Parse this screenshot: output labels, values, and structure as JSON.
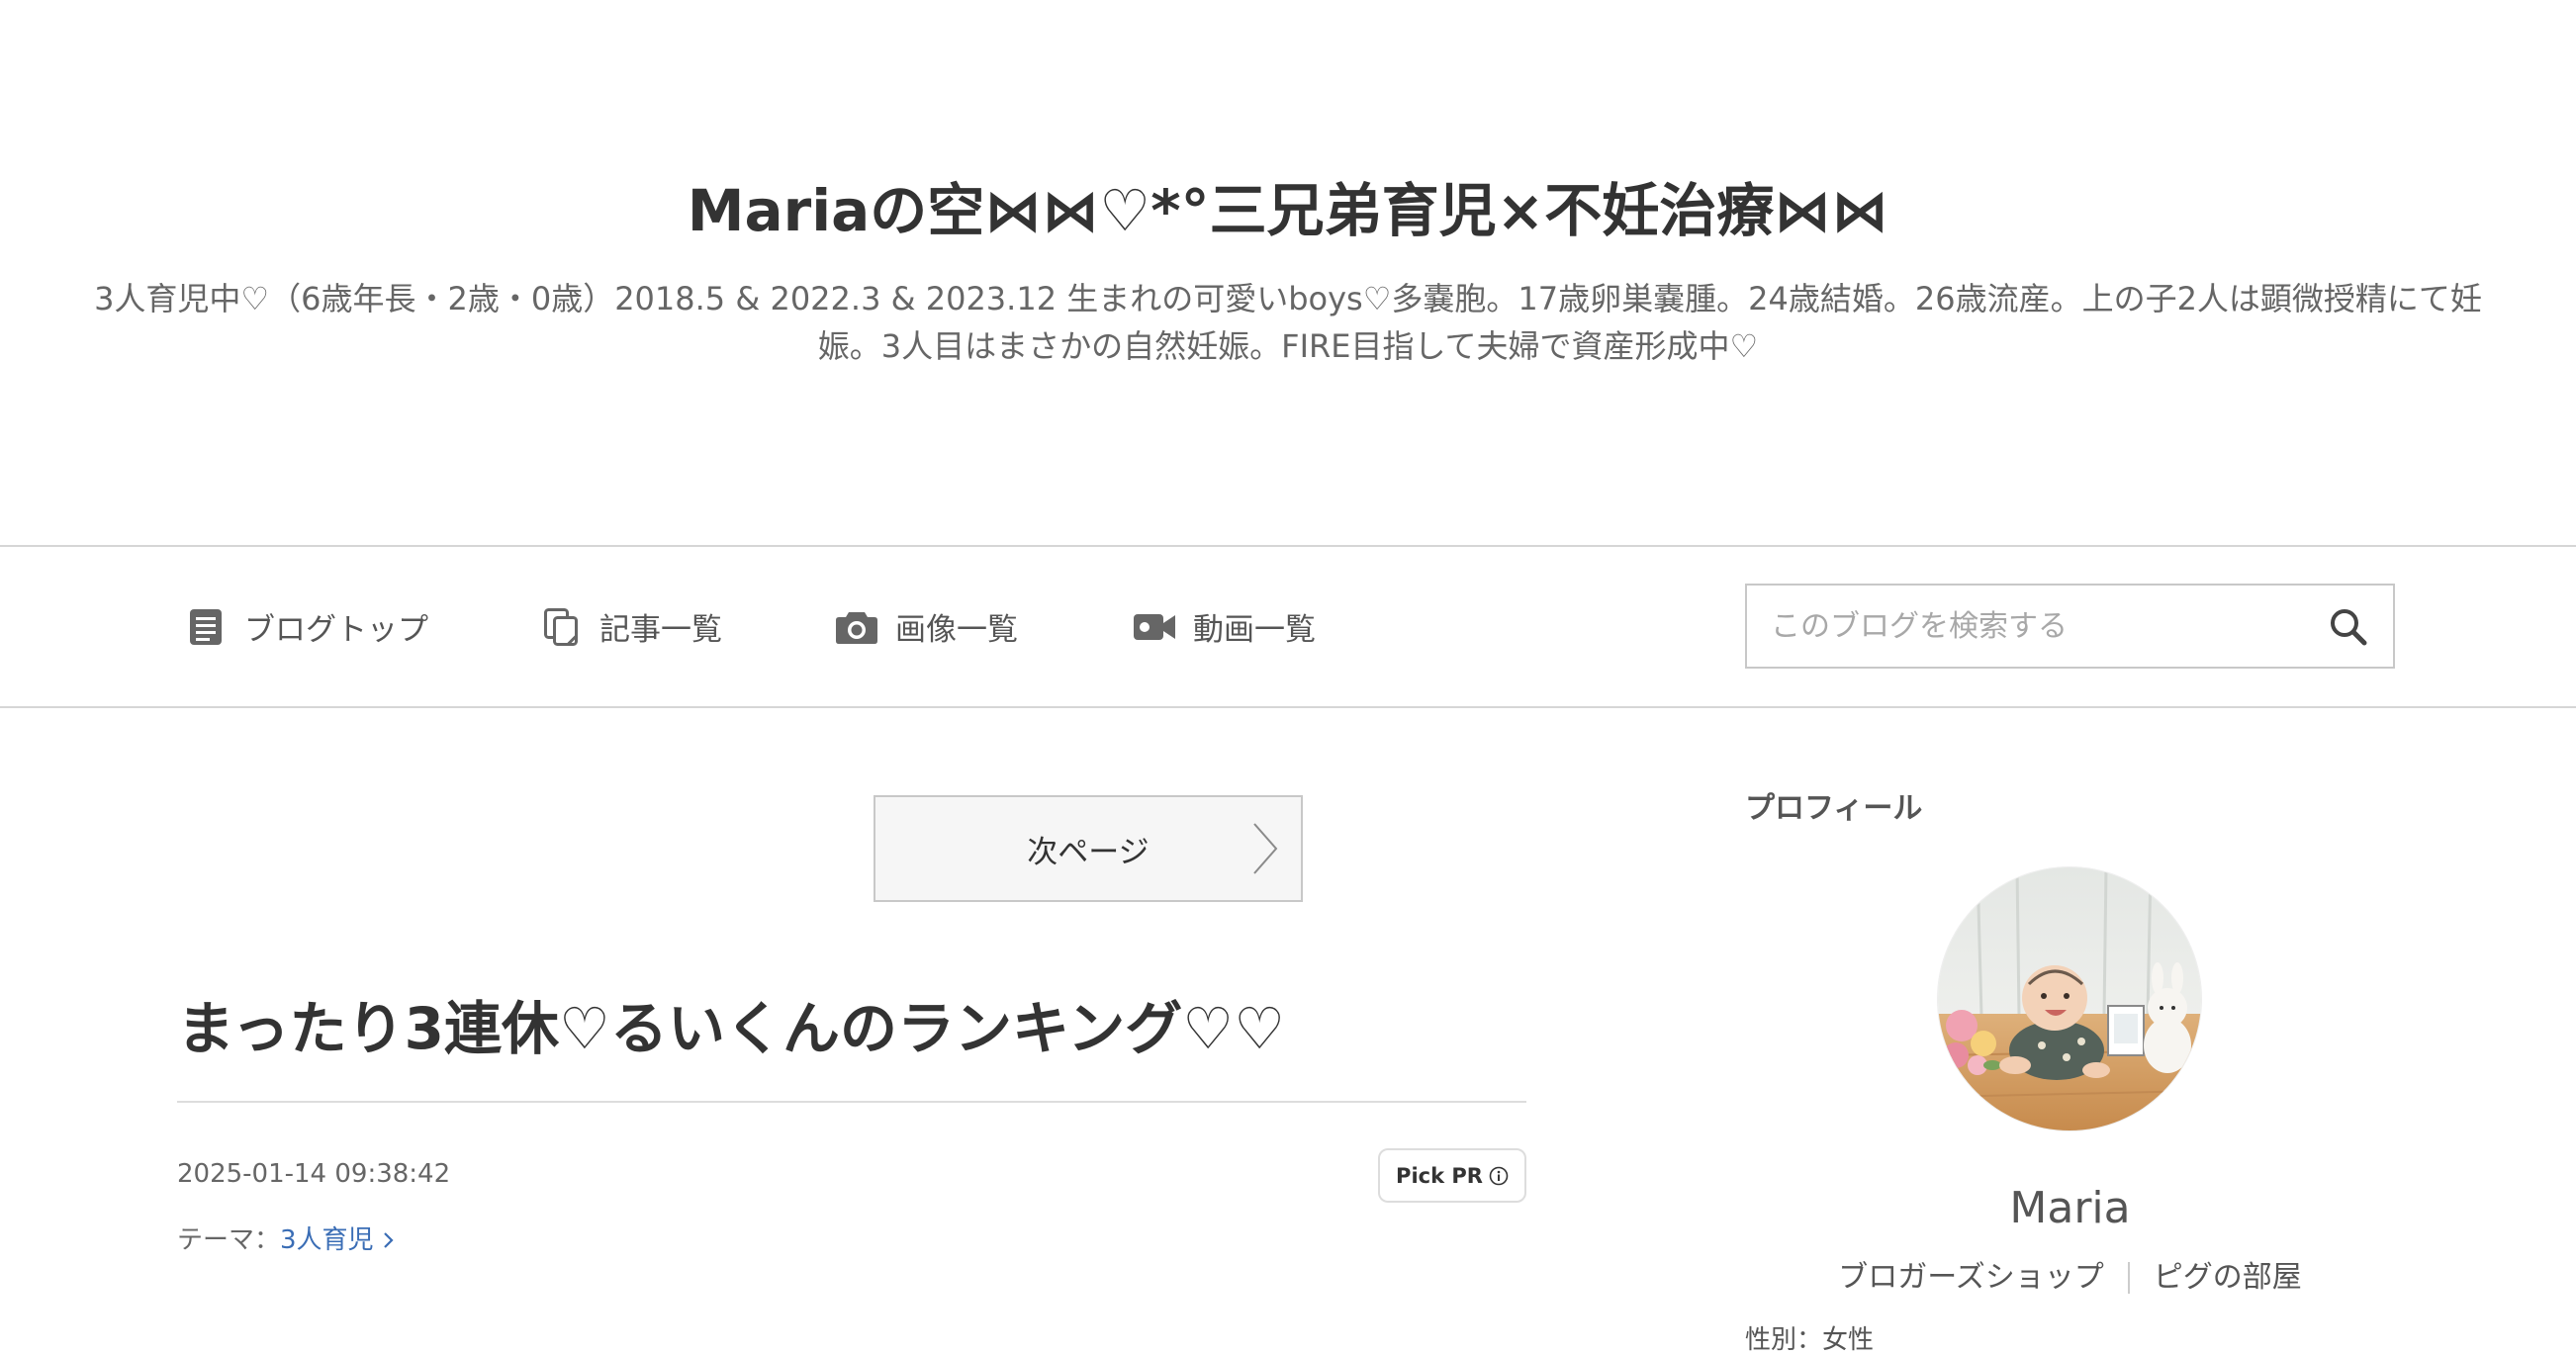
{
  "blog": {
    "title": "Mariaの空⋈⋈♡*°三兄弟育児×不妊治療⋈⋈",
    "description": "3人育児中♡（6歳年長・2歳・0歳）2018.5 & 2022.3 & 2023.12 生まれの可愛いboys♡多嚢胞。17歳卵巣嚢腫。24歳結婚。26歳流産。上の子2人は顕微授精にて妊娠。3人目はまさかの自然妊娠。FIRE目指して夫婦で資産形成中♡"
  },
  "nav": {
    "items": [
      {
        "label": "ブログトップ",
        "icon": "document-icon"
      },
      {
        "label": "記事一覧",
        "icon": "copy-documents-icon"
      },
      {
        "label": "画像一覧",
        "icon": "camera-icon"
      },
      {
        "label": "動画一覧",
        "icon": "video-camera-icon"
      }
    ],
    "search": {
      "placeholder": "このブログを検索する",
      "icon": "search-icon"
    }
  },
  "pager": {
    "next_label": "次ページ",
    "icon": "chevron-right-icon"
  },
  "article": {
    "title": "まったり3連休♡るいくんのランキング♡♡",
    "date": "2025-01-14 09:38:42",
    "pick_pr_label": "Pick PR",
    "pick_pr_icon": "info-icon",
    "theme_prefix": "テーマ：",
    "theme_label": "3人育児"
  },
  "sidebar": {
    "profile_heading": "プロフィール",
    "name": "Maria",
    "links": [
      "ブロガーズショップ",
      "ピグの部屋"
    ],
    "gender": "性別：女性"
  },
  "colors": {
    "text": "#333333",
    "muted": "#666666",
    "link": "#3a6db5",
    "border": "#dddddd",
    "button_bg": "#f6f6f6"
  }
}
